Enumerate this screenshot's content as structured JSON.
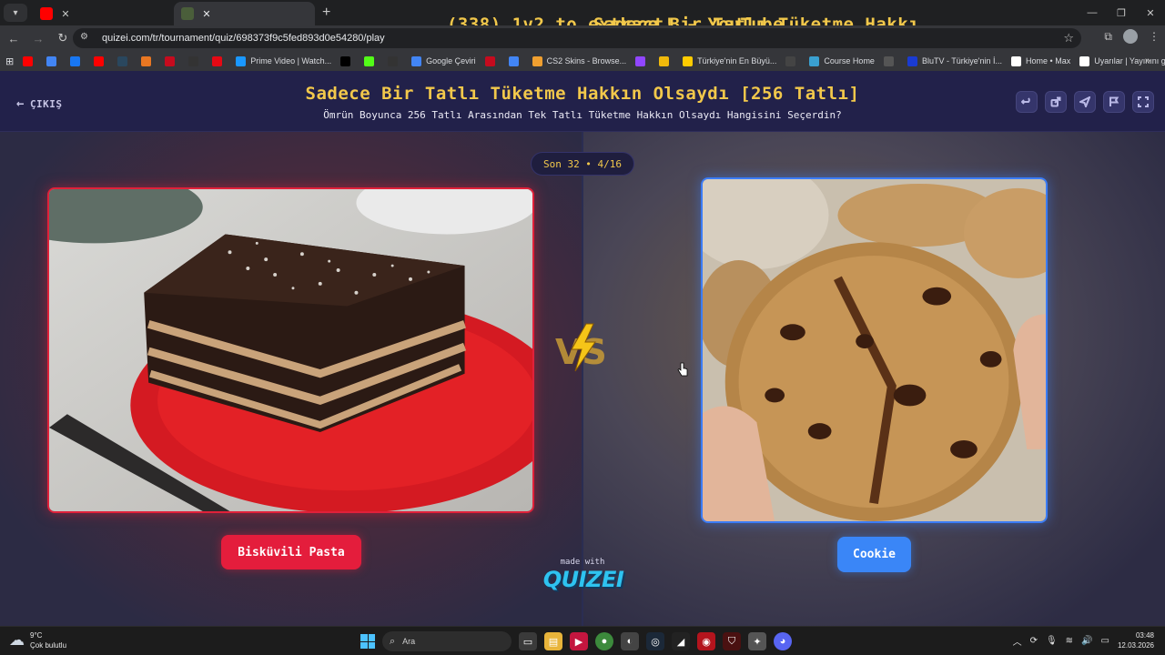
{
  "browser": {
    "tabs": [
      {
        "title": "(338) 1v2 to extract! - YouTube",
        "favicon_color": "#ff0000",
        "active": false
      },
      {
        "title": "Sadece Bir Tatlı Tüketme Hakkı",
        "favicon_color": "#4a5e3a",
        "active": true
      }
    ],
    "url": "quizei.com/tr/tournament/quiz/698373f9c5fed893d0e54280/play",
    "bookmarks": [
      {
        "label": "",
        "color": "#ff0000"
      },
      {
        "label": "",
        "color": "#4285f4"
      },
      {
        "label": "",
        "color": "#1877f2"
      },
      {
        "label": "",
        "color": "#ff0000"
      },
      {
        "label": "",
        "color": "#2a475e"
      },
      {
        "label": "",
        "color": "#e87722"
      },
      {
        "label": "",
        "color": "#c60b1e"
      },
      {
        "label": "",
        "color": "#333333"
      },
      {
        "label": "",
        "color": "#e50914"
      },
      {
        "label": "Prime Video | Watch...",
        "color": "#1a98ff"
      },
      {
        "label": "",
        "color": "#000000"
      },
      {
        "label": "",
        "color": "#53fc18"
      },
      {
        "label": "",
        "color": "#333333"
      },
      {
        "label": "Google Çeviri",
        "color": "#4285f4"
      },
      {
        "label": "",
        "color": "#c60b1e"
      },
      {
        "label": "",
        "color": "#4285f4"
      },
      {
        "label": "CS2 Skins - Browse...",
        "color": "#f0a030"
      },
      {
        "label": "",
        "color": "#9146ff"
      },
      {
        "label": "",
        "color": "#f0b90b"
      },
      {
        "label": "Türkiye'nin En Büyü...",
        "color": "#ffcc00"
      },
      {
        "label": "",
        "color": "#444444"
      },
      {
        "label": "Course Home",
        "color": "#3aa0d0"
      },
      {
        "label": "",
        "color": "#555555"
      },
      {
        "label": "BluTV - Türkiye'nin İ...",
        "color": "#1a3bd1"
      },
      {
        "label": "Home • Max",
        "color": "#ffffff"
      },
      {
        "label": "Uyarılar | Yayınını gü...",
        "color": "#ffffff"
      }
    ]
  },
  "header": {
    "exit_label": "ÇIKIŞ",
    "title": "Sadece Bir Tatlı Tüketme Hakkın Olsaydı [256 Tatlı]",
    "subtitle": "Ömrün Boyunca 256 Tatlı Arasından Tek Tatlı Tüketme Hakkın Olsaydı Hangisini Seçerdin?"
  },
  "round": "Son 32 • 4/16",
  "choices": {
    "left": {
      "label": "Bisküvili Pasta",
      "accent": "#e41d3c"
    },
    "right": {
      "label": "Cookie",
      "accent": "#3a86f7"
    }
  },
  "vs_text": "VS",
  "footer": {
    "made_with": "made with",
    "brand": "QUIZEI"
  },
  "taskbar": {
    "weather_temp": "9°C",
    "weather_desc": "Çok bulutlu",
    "search_placeholder": "Ara",
    "time": "03:48",
    "date": "12.03.2026"
  }
}
